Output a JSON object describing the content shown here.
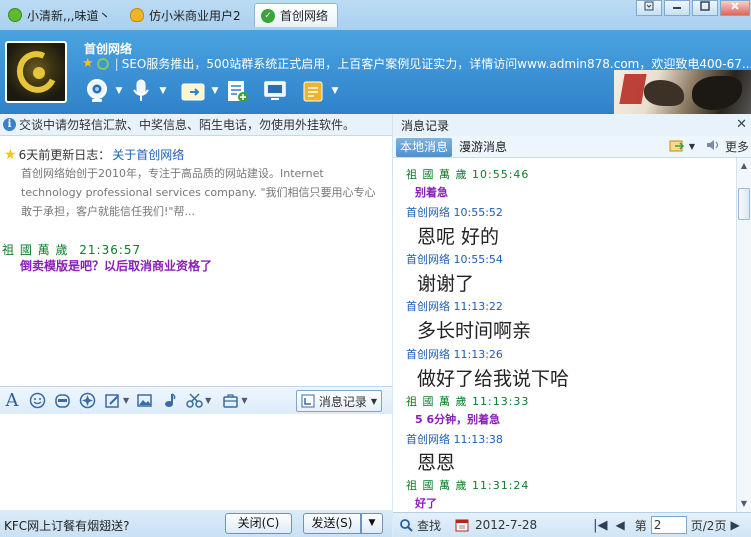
{
  "tabs": [
    {
      "label": "小清新,,,味道丶",
      "icon": "smile-icon"
    },
    {
      "label": "仿小米商业用户2",
      "icon": "user-icon"
    },
    {
      "label": "首创网络",
      "icon": "check-icon"
    }
  ],
  "window_controls": {
    "minimize": "▭",
    "maximize": "▭",
    "close": "✕"
  },
  "contact": {
    "name": "首创网络",
    "signature": "SEO服务推出，500站群系统正式启用，上百客户案例见证实力，详情访问www.admin878.com，欢迎致电400-67..."
  },
  "notice": "交谈中请勿轻信汇款、中奖信息、陌生电话，勿使用外挂软件。",
  "update": {
    "prefix": "6天前更新日志：",
    "link": "关于首创网络",
    "body": "首创网络始创于2010年，专注于高品质的网站建设。Internet technology professional services company. \"我们相信只要用心专心敢于承担，客户就能信任我们!\"帮..."
  },
  "chat_message": {
    "sender": "祖 國 萬 歲",
    "time": "21:36:57",
    "text": "倒卖模版是吧？以后取消商业资格了"
  },
  "history_button": "消息记录",
  "bottom": {
    "tip": "KFC网上订餐有烟翅送?",
    "close": "关闭(C)",
    "send": "发送(S)"
  },
  "right": {
    "title": "消息记录",
    "tab_local": "本地消息",
    "tab_roam": "漫游消息",
    "more": "更多",
    "messages": [
      {
        "sender": "祖 國 萬 歲",
        "time": "10:55:46",
        "text": "别着急",
        "kind": "small",
        "color": "green"
      },
      {
        "sender": "首创网络",
        "time": "10:55:52",
        "text": "恩呢 好的",
        "kind": "large",
        "color": "blue"
      },
      {
        "sender": "首创网络",
        "time": "10:55:54",
        "text": "谢谢了",
        "kind": "large",
        "color": "blue"
      },
      {
        "sender": "首创网络",
        "time": "11:13:22",
        "text": "多长时间啊亲",
        "kind": "large",
        "color": "blue"
      },
      {
        "sender": "首创网络",
        "time": "11:13:26",
        "text": "做好了给我说下哈",
        "kind": "large",
        "color": "blue"
      },
      {
        "sender": "祖 國 萬 歲",
        "time": "11:13:33",
        "text": "5 6分钟，别着急",
        "kind": "small",
        "color": "green"
      },
      {
        "sender": "首创网络",
        "time": "11:13:38",
        "text": "恩恩",
        "kind": "large",
        "color": "blue"
      },
      {
        "sender": "祖 國 萬 歲",
        "time": "11:31:24",
        "text": "好了",
        "kind": "small",
        "color": "green"
      }
    ],
    "footer": {
      "find": "查找",
      "date": "2012-7-28",
      "page_label": "第",
      "page_value": "2",
      "page_total": "页/2页"
    }
  }
}
